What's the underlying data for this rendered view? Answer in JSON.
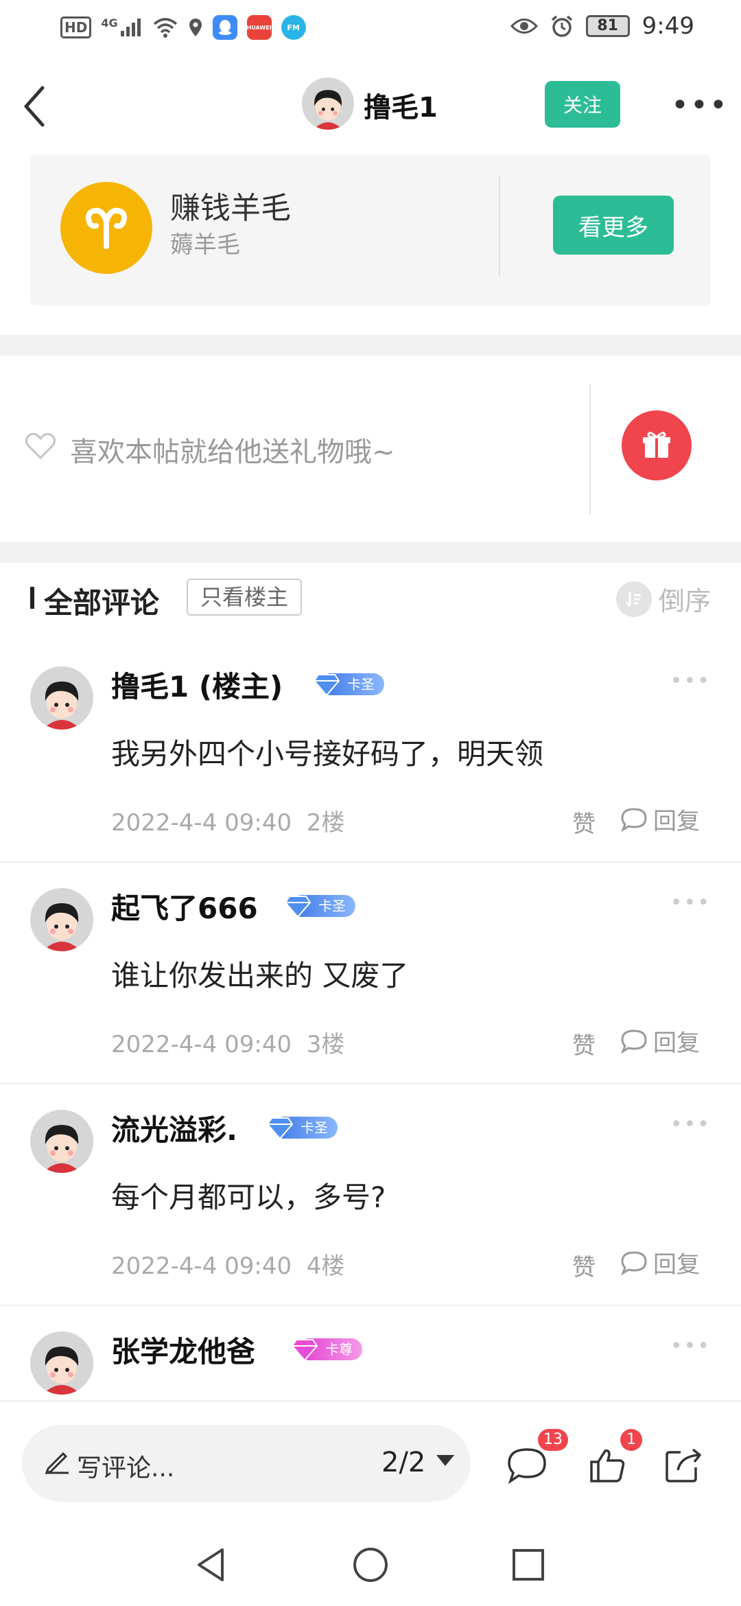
{
  "status_bar": {
    "hd": "HD",
    "net": "4G",
    "battery": "81",
    "time": "9:49",
    "app_icons": [
      "qq-icon",
      "huawei-icon",
      "fm-icon"
    ],
    "app_labels": [
      "",
      "HUAWEI",
      "FM"
    ]
  },
  "header": {
    "title": "撸毛1",
    "follow_label": "关注",
    "more_label": "•••"
  },
  "community": {
    "name": "赚钱羊毛",
    "sub": "薅羊毛",
    "see_more_label": "看更多"
  },
  "gift": {
    "prompt": "喜欢本帖就给他送礼物哦~"
  },
  "comments_header": {
    "title": "全部评论",
    "only_op_label": "只看楼主",
    "sort_label": "倒序"
  },
  "comments": [
    {
      "name": "撸毛1 (楼主)",
      "badge": "卡圣",
      "text": "我另外四个小号接好码了，明天领",
      "date": "2022-4-4 09:40",
      "floor": "2楼",
      "like": "赞",
      "reply": "回复"
    },
    {
      "name": "起飞了666",
      "badge": "卡圣",
      "text": "谁让你发出来的  又废了",
      "date": "2022-4-4 09:40",
      "floor": "3楼",
      "like": "赞",
      "reply": "回复"
    },
    {
      "name": "流光溢彩.",
      "badge": "卡圣",
      "text": "每个月都可以，多号?",
      "date": "2022-4-4 09:40",
      "floor": "4楼",
      "like": "赞",
      "reply": "回复"
    },
    {
      "name": "张学龙他爸",
      "badge": "卡尊",
      "text": "",
      "date": "",
      "floor": "",
      "like": "",
      "reply": ""
    }
  ],
  "bottom_bar": {
    "write_placeholder": "写评论...",
    "page": "2/2",
    "comment_count": "13",
    "like_count": "1"
  },
  "colors": {
    "accent": "#2dbd96",
    "badge_blue": "#4f8ff0",
    "badge_pink": "#e84bd8",
    "red": "#f0454c",
    "logo_yellow": "#f6b404"
  }
}
